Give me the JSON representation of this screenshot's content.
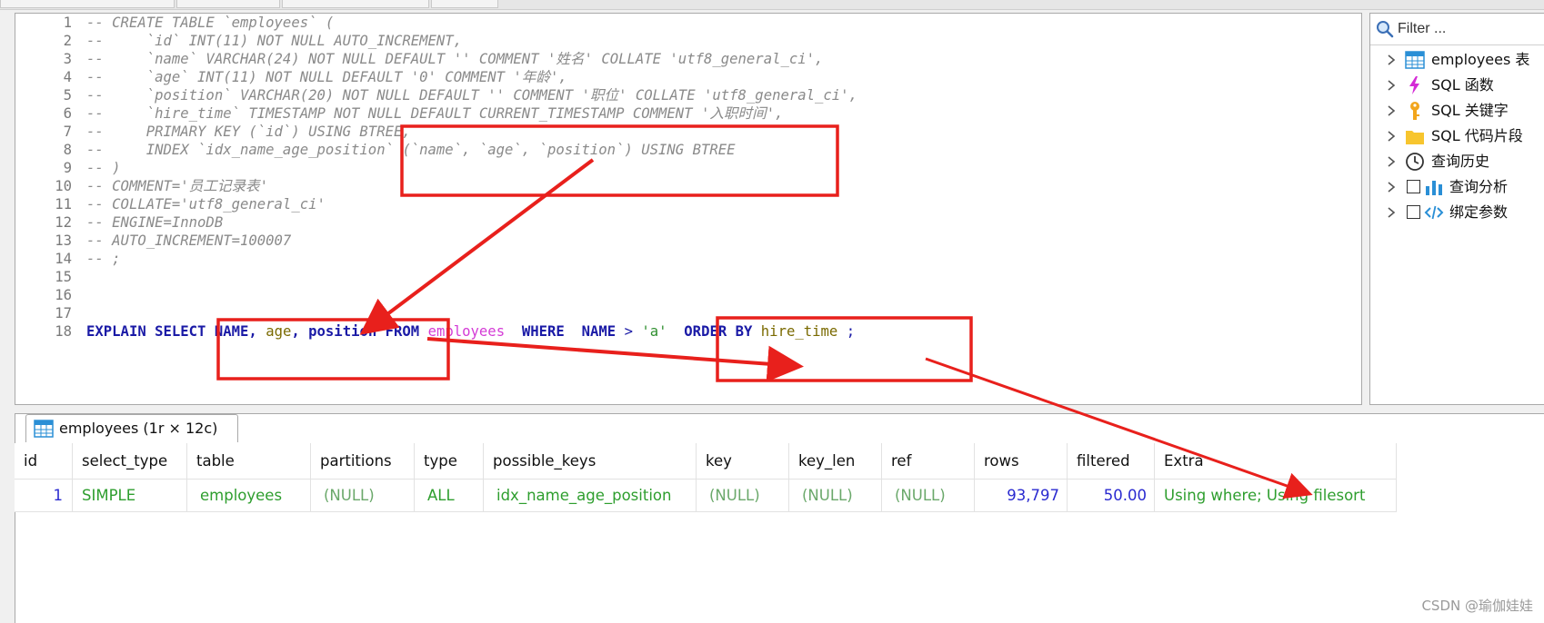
{
  "editor": {
    "line_numbers": [
      "1",
      "2",
      "3",
      "4",
      "5",
      "6",
      "7",
      "8",
      "9",
      "10",
      "11",
      "12",
      "13",
      "14",
      "15",
      "16",
      "17",
      "18"
    ],
    "comment_lines": [
      "-- CREATE TABLE `employees` (",
      "--     `id` INT(11) NOT NULL AUTO_INCREMENT,",
      "--     `name` VARCHAR(24) NOT NULL DEFAULT '' COMMENT '姓名' COLLATE 'utf8_general_ci',",
      "--     `age` INT(11) NOT NULL DEFAULT '0' COMMENT '年龄',",
      "--     `position` VARCHAR(20) NOT NULL DEFAULT '' COMMENT '职位' COLLATE 'utf8_general_ci',",
      "--     `hire_time` TIMESTAMP NOT NULL DEFAULT CURRENT_TIMESTAMP COMMENT '入职时间',",
      "--     PRIMARY KEY (`id`) USING BTREE,",
      "--     INDEX `idx_name_age_position` (`name`, `age`, `position`) USING BTREE",
      "-- )",
      "-- COMMENT='员工记录表'",
      "-- COLLATE='utf8_general_ci'",
      "-- ENGINE=InnoDB",
      "-- AUTO_INCREMENT=100007",
      "-- ;"
    ],
    "query": {
      "explain": "EXPLAIN",
      "select": "SELECT",
      "col_name": "NAME,",
      "col_age": "age",
      "comma": ",",
      "col_position": "position",
      "from": "FROM",
      "table": "employees",
      "where": "WHERE",
      "where_col": "NAME",
      "gt": ">",
      "literal": "'a'",
      "order_by": "ORDER BY",
      "order_col": "hire_time",
      "semicolon": ";"
    }
  },
  "side_panel": {
    "filter_placeholder": "Filter ...",
    "items": [
      {
        "label": "employees 表",
        "icon": "table-icon"
      },
      {
        "label": "SQL 函数",
        "icon": "lightning-icon"
      },
      {
        "label": "SQL 关键字",
        "icon": "key-icon"
      },
      {
        "label": "SQL 代码片段",
        "icon": "folder-icon"
      },
      {
        "label": "查询历史",
        "icon": "clock-icon"
      },
      {
        "label": "查询分析",
        "icon": "bar-chart-icon"
      },
      {
        "label": "绑定参数",
        "icon": "code-icon"
      }
    ]
  },
  "result": {
    "tab_label": "employees (1r × 12c)",
    "columns": [
      "id",
      "select_type",
      "table",
      "partitions",
      "type",
      "possible_keys",
      "key",
      "key_len",
      "ref",
      "rows",
      "filtered",
      "Extra"
    ],
    "rows": [
      [
        "1",
        "SIMPLE",
        "employees",
        "(NULL)",
        "ALL",
        "idx_name_age_position",
        "(NULL)",
        "(NULL)",
        "(NULL)",
        "93,797",
        "50.00",
        "Using where; Using filesort"
      ]
    ]
  },
  "watermark": "CSDN @瑜伽娃娃",
  "colors": {
    "keyword": "#1a1aa6",
    "comment": "#8a8a8a",
    "table_name": "#d43cd6",
    "string": "#2f8f2f",
    "annotation_red": "#e8201c"
  }
}
